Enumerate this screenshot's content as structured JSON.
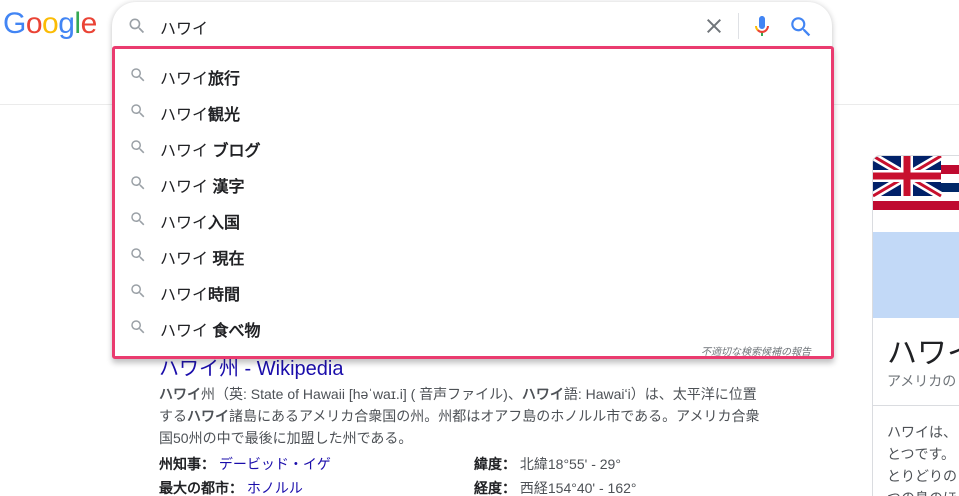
{
  "logo": {
    "letters": [
      "G",
      "o",
      "o",
      "g",
      "l",
      "e"
    ],
    "colors": [
      "#4285F4",
      "#EA4335",
      "#FBBC05",
      "#4285F4",
      "#34A853",
      "#EA4335"
    ]
  },
  "search": {
    "query": "ハワイ"
  },
  "icons": {
    "search": "search-icon",
    "clear": "close-icon",
    "mic": "mic-icon"
  },
  "suggestions": [
    {
      "base": "ハワイ",
      "completion": "旅行"
    },
    {
      "base": "ハワイ",
      "completion": "観光"
    },
    {
      "base": "ハワイ ",
      "completion": "ブログ"
    },
    {
      "base": "ハワイ ",
      "completion": "漢字"
    },
    {
      "base": "ハワイ",
      "completion": "入国"
    },
    {
      "base": "ハワイ ",
      "completion": "現在"
    },
    {
      "base": "ハワイ",
      "completion": "時間"
    },
    {
      "base": "ハワイ ",
      "completion": "食べ物"
    }
  ],
  "report_label": "不適切な検索候補の報告",
  "result": {
    "title": "ハワイ州 - Wikipedia",
    "snippet_parts": [
      {
        "t": "ハワイ",
        "b": true
      },
      {
        "t": "州（英: State of Hawaii [həˈwaɪ.i] ( 音声ファイル)、",
        "b": false
      },
      {
        "t": "ハワイ",
        "b": true
      },
      {
        "t": "語: Hawaiʻi）は、太平洋に位置する",
        "b": false
      },
      {
        "t": "ハワイ",
        "b": true
      },
      {
        "t": "諸島にあるアメリカ合衆国の州。州都はオアフ島のホノルル市である。アメリカ合衆国50州の中で最後に加盟した州である。",
        "b": false
      }
    ],
    "facts": [
      {
        "key": "州知事：",
        "value": "デービッド・イゲ",
        "link": true
      },
      {
        "key": "緯度：",
        "value": "北緯18°55' - 29°",
        "link": false
      },
      {
        "key": "最大の都市：",
        "value": "ホノルル",
        "link": true
      },
      {
        "key": "経度：",
        "value": "西経154°40' - 162°",
        "link": false
      }
    ]
  },
  "knowledge_panel": {
    "title": "ハワイ",
    "subtitle": "アメリカの",
    "desc_lines": [
      "ハワイは、",
      "とつです。",
      "とりどりの",
      "つの島のほ"
    ]
  }
}
